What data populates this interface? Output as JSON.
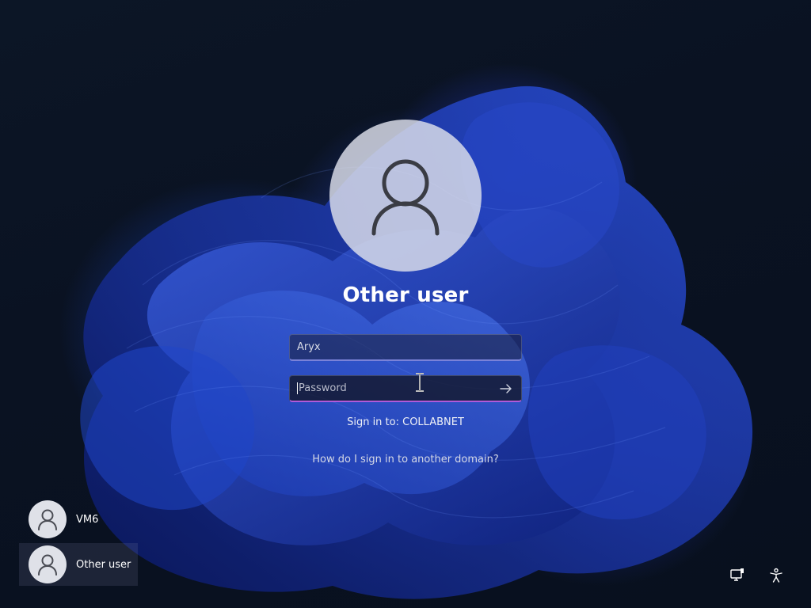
{
  "login": {
    "title": "Other user",
    "username_value": "Aryx",
    "password_placeholder": "Password",
    "sign_in_to": "Sign in to: COLLABNET",
    "domain_help_link": "How do I sign in to another domain?"
  },
  "user_list": [
    {
      "name": "VM6",
      "selected": false
    },
    {
      "name": "Other user",
      "selected": true
    }
  ],
  "icons": {
    "avatar": "person-icon",
    "submit": "arrow-right-icon",
    "network": "network-icon",
    "accessibility": "accessibility-icon"
  },
  "colors": {
    "username_underline": "#7a82d8",
    "password_underline": "#b05ad8",
    "avatar_bg": "#dee0ec"
  }
}
